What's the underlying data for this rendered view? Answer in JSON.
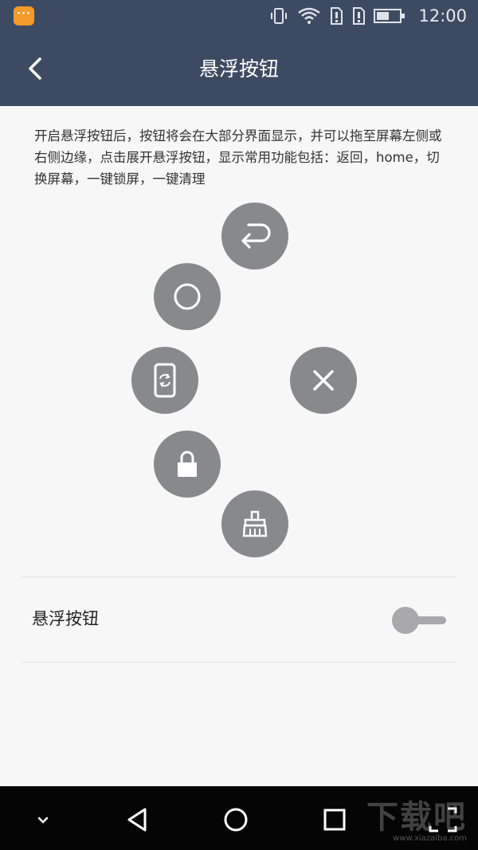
{
  "status_bar": {
    "notification_icon": "app-notification-icon",
    "time": "12:00"
  },
  "header": {
    "title": "悬浮按钮",
    "back_icon": "chevron-left-icon"
  },
  "description": "开启悬浮按钮后，按钮将会在大部分界面显示，并可以拖至屏幕左侧或右侧边缘，点击展开悬浮按钮，显示常用功能包括：返回，home，切换屏幕，一键锁屏，一键清理",
  "floating_buttons": [
    {
      "name": "back-fab",
      "icon": "return-arrow-icon"
    },
    {
      "name": "home-fab",
      "icon": "circle-home-icon"
    },
    {
      "name": "switch-screen-fab",
      "icon": "phone-rotate-icon"
    },
    {
      "name": "close-fab",
      "icon": "close-icon"
    },
    {
      "name": "lock-fab",
      "icon": "lock-icon"
    },
    {
      "name": "clean-fab",
      "icon": "brush-icon"
    }
  ],
  "setting": {
    "label": "悬浮按钮",
    "toggle_on": false
  },
  "nav_bar": {
    "items": [
      "chevron-down-icon",
      "back-triangle-icon",
      "home-circle-icon",
      "recents-square-icon",
      "fullscreen-icon"
    ]
  },
  "watermark": {
    "text": "下载吧",
    "url": "www.xiazaiba.com"
  },
  "colors": {
    "header_bg": "#3d4b62",
    "fab_bg": "#88898d",
    "notification": "#f39a2b"
  }
}
